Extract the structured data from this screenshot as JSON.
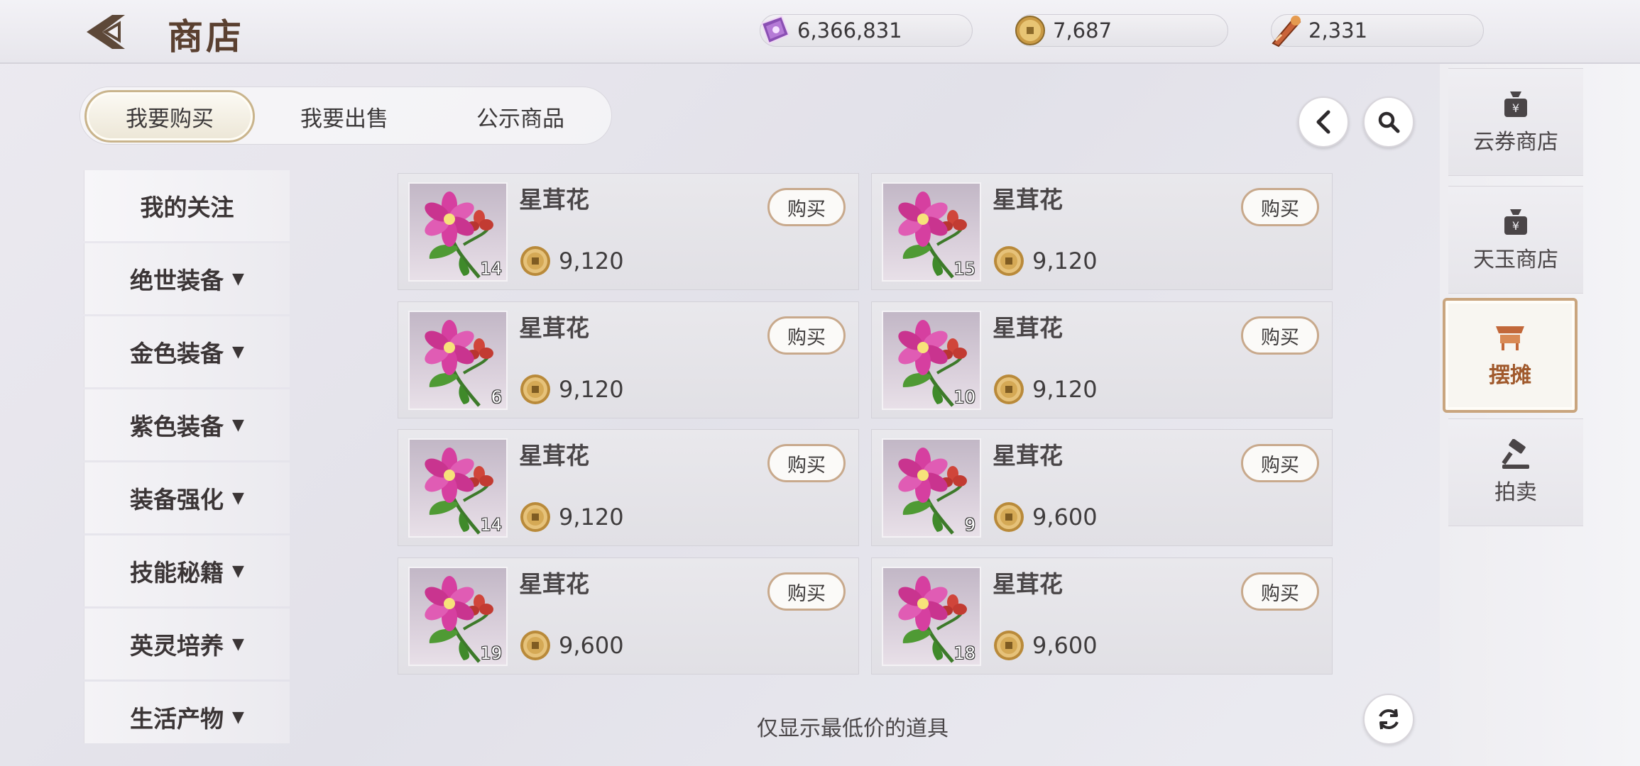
{
  "header": {
    "title": "商店",
    "currencies": [
      {
        "icon": "ticket-icon",
        "value": "6,366,831"
      },
      {
        "icon": "coin-icon",
        "value": "7,687"
      },
      {
        "icon": "jade-icon",
        "value": "2,331"
      }
    ]
  },
  "tabs": [
    "我要购买",
    "我要出售",
    "公示商品"
  ],
  "categories": [
    "我的关注",
    "绝世装备",
    "金色装备",
    "紫色装备",
    "装备强化",
    "技能秘籍",
    "英灵培养",
    "生活产物"
  ],
  "buy_label": "购买",
  "items": [
    {
      "name": "星茸花",
      "qty": "14",
      "price": "9,120"
    },
    {
      "name": "星茸花",
      "qty": "15",
      "price": "9,120"
    },
    {
      "name": "星茸花",
      "qty": "6",
      "price": "9,120"
    },
    {
      "name": "星茸花",
      "qty": "10",
      "price": "9,120"
    },
    {
      "name": "星茸花",
      "qty": "14",
      "price": "9,120"
    },
    {
      "name": "星茸花",
      "qty": "9",
      "price": "9,600"
    },
    {
      "name": "星茸花",
      "qty": "19",
      "price": "9,600"
    },
    {
      "name": "星茸花",
      "qty": "18",
      "price": "9,600"
    }
  ],
  "footnote": "仅显示最低价的道具",
  "side_nav": [
    {
      "label": "云券商店",
      "icon": "money-bag-icon",
      "active": false
    },
    {
      "label": "天玉商店",
      "icon": "money-bag-icon",
      "active": false
    },
    {
      "label": "摆摊",
      "icon": "stall-icon",
      "active": true
    },
    {
      "label": "拍卖",
      "icon": "gavel-icon",
      "active": false
    }
  ],
  "colors": {
    "accent": "#c9a57e",
    "active_text": "#a0592c",
    "flower": "#d63fa0"
  }
}
